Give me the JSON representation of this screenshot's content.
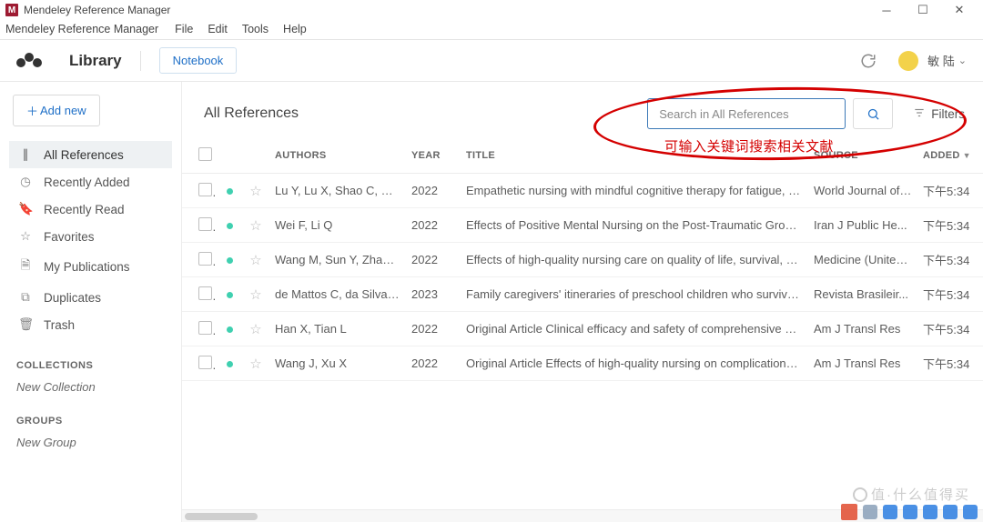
{
  "titlebar": {
    "appName": "Mendeley Reference Manager"
  },
  "menubar": {
    "appName": "Mendeley Reference Manager",
    "items": [
      "File",
      "Edit",
      "Tools",
      "Help"
    ]
  },
  "header": {
    "library": "Library",
    "notebook": "Notebook",
    "username": "敏 陆"
  },
  "sidebar": {
    "addNew": "Add new",
    "items": [
      {
        "icon": "∥",
        "label": "All References",
        "active": true
      },
      {
        "icon": "◷",
        "label": "Recently Added",
        "active": false
      },
      {
        "icon": "🔖",
        "label": "Recently Read",
        "active": false
      },
      {
        "icon": "☆",
        "label": "Favorites",
        "active": false
      },
      {
        "icon": "🗎",
        "label": "My Publications",
        "active": false
      },
      {
        "icon": "⧉",
        "label": "Duplicates",
        "active": false
      },
      {
        "icon": "🗑",
        "label": "Trash",
        "active": false
      }
    ],
    "collectionsLabel": "COLLECTIONS",
    "newCollection": "New Collection",
    "groupsLabel": "GROUPS",
    "newGroup": "New Group"
  },
  "content": {
    "title": "All References",
    "searchPlaceholder": "Search in All References",
    "filtersLabel": "Filters"
  },
  "annotation": {
    "text": "可输入关键词搜索相关文献"
  },
  "table": {
    "columns": {
      "authors": "AUTHORS",
      "year": "YEAR",
      "title": "TITLE",
      "source": "SOURCE",
      "added": "ADDED"
    },
    "rows": [
      {
        "authors": "Lu Y, Lu X, Shao C, W...",
        "year": "2022",
        "title": "Empathetic nursing with mindful cognitive therapy for fatigue, depression...",
        "source": "World Journal of ...",
        "added": "下午5:34"
      },
      {
        "authors": "Wei F, Li Q",
        "year": "2022",
        "title": "Effects of Positive Mental Nursing on the Post-Traumatic Growth, Negati...",
        "source": "Iran J Public He...",
        "added": "下午5:34"
      },
      {
        "authors": "Wang M, Sun Y, Zhang...",
        "year": "2022",
        "title": "Effects of high-quality nursing care on quality of life, survival, and recurr...",
        "source": "Medicine (United...",
        "added": "下午5:34"
      },
      {
        "authors": "de Mattos C, da Silva L...",
        "year": "2023",
        "title": "Family caregivers' itineraries of preschool children who survived leukemi...",
        "source": "Revista Brasileir...",
        "added": "下午5:34"
      },
      {
        "authors": "Han X, Tian L",
        "year": "2022",
        "title": "Original Article Clinical efficacy and safety of comprehensive nursing inte...",
        "source": "Am J Transl Res",
        "added": "下午5:34"
      },
      {
        "authors": "Wang J, Xu X",
        "year": "2022",
        "title": "Original Article Effects of high-quality nursing on complications of periph...",
        "source": "Am J Transl Res",
        "added": "下午5:34"
      }
    ]
  },
  "watermark": {
    "text": "值·什么值得买"
  }
}
